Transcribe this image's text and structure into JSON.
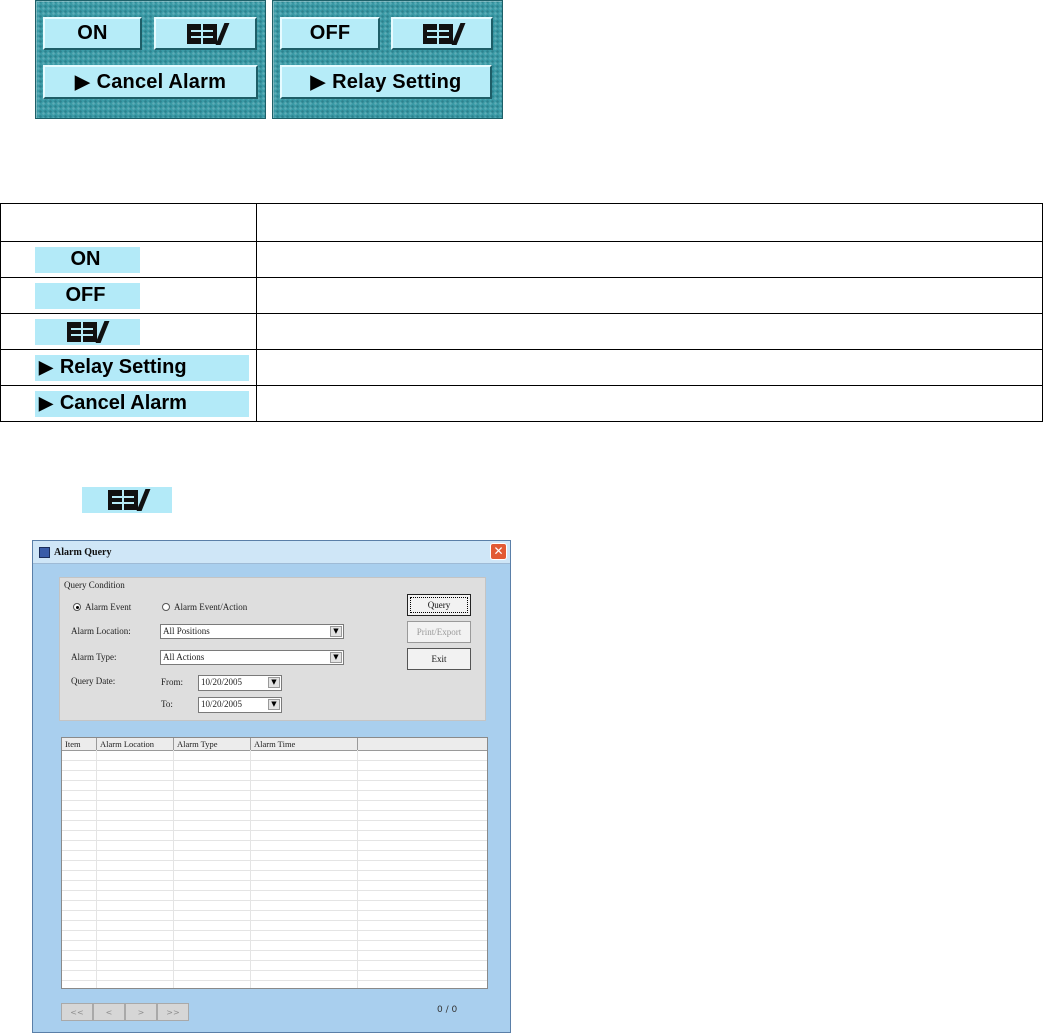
{
  "panel_left": {
    "on_label": "ON",
    "cancel_alarm_label": "Cancel Alarm"
  },
  "panel_right": {
    "off_label": "OFF",
    "relay_setting_label": "Relay Setting"
  },
  "icons": {
    "ebook": "ebook-pen-icon",
    "play": "play-triangle-icon"
  },
  "table": {
    "rows": [
      {
        "label": "ON"
      },
      {
        "label": "OFF"
      },
      {
        "label": ""
      },
      {
        "label": "Relay Setting"
      },
      {
        "label": "Cancel Alarm"
      }
    ]
  },
  "dialog": {
    "title": "Alarm Query",
    "close_symbol": "✕",
    "group_title": "Query Condition",
    "radio_event": "Alarm Event",
    "radio_event_action": "Alarm Event/Action",
    "location_label": "Alarm Location:",
    "location_value": "All Positions",
    "type_label": "Alarm Type:",
    "type_value": "All Actions",
    "date_label": "Query Date:",
    "from_label": "From:",
    "from_value": "10/20/2005",
    "to_label": "To:",
    "to_value": "10/20/2005",
    "query_button": "Query",
    "print_button": "Print/Export",
    "exit_button": "Exit",
    "columns": [
      "Item",
      "Alarm Location",
      "Alarm Type",
      "Alarm Time",
      ""
    ],
    "pager": [
      "<<",
      "<",
      ">",
      ">>"
    ],
    "counter": "0 / 0"
  },
  "colors": {
    "panel_teal": "#3a9aa6",
    "button_cyan": "#b6ecf8",
    "dialog_blue": "#a9cfee"
  }
}
